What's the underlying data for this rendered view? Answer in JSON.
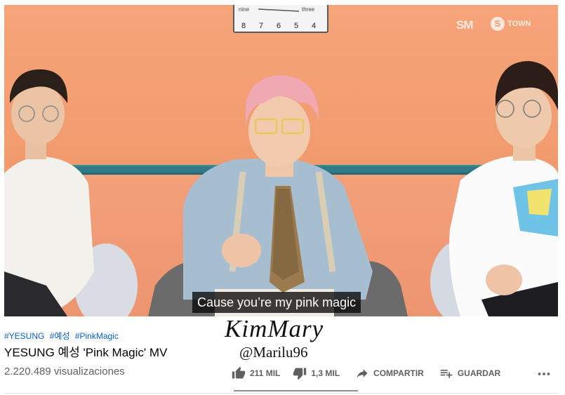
{
  "video": {
    "clock": {
      "numbers": [
        "8",
        "7",
        "6",
        "5",
        "4"
      ],
      "label_left": "nine",
      "label_right": "three"
    },
    "logos": {
      "sm": "SM",
      "town": "TOWN",
      "town_badge": "S"
    },
    "subtitle": "Cause you’re my pink magic"
  },
  "info": {
    "hashtags": [
      "#YESUNG",
      "#예성",
      "#PinkMagic"
    ],
    "title": "YESUNG 예성 'Pink Magic' MV",
    "views": "2.220.489 visualizaciones"
  },
  "watermark": {
    "name": "KimMary",
    "handle": "@Marilu96"
  },
  "actions": {
    "like": "211 MIL",
    "dislike": "1,3 MIL",
    "share": "COMPARTIR",
    "save": "GUARDAR"
  },
  "icons": [
    "thumbs-up-icon",
    "thumbs-down-icon",
    "share-arrow-icon",
    "playlist-add-icon",
    "more-dots-icon"
  ],
  "colors": {
    "wall": "#f39c70",
    "rail": "#2f7a86",
    "hashtag": "#065fd4",
    "meta": "#606060"
  }
}
